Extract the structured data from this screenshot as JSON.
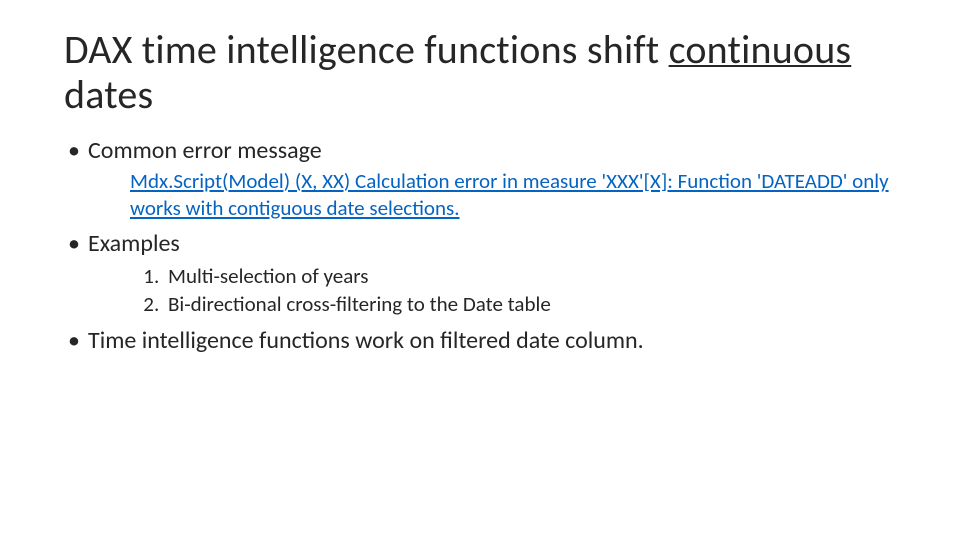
{
  "title": {
    "pre": "DAX time intelligence functions shift ",
    "underlined": "continuous",
    "post": " dates"
  },
  "bullets": {
    "b1": "Common error message",
    "b1_sub": "Mdx.Script(Model) (X, XX) Calculation error in measure 'XXX'[X]: Function 'DATEADD' only works with contiguous date selections.",
    "b2": "Examples",
    "b2_items": {
      "i1": "Multi-selection of years",
      "i2": "Bi-directional cross-filtering to the Date table"
    },
    "b3": "Time intelligence functions work on filtered date column."
  }
}
